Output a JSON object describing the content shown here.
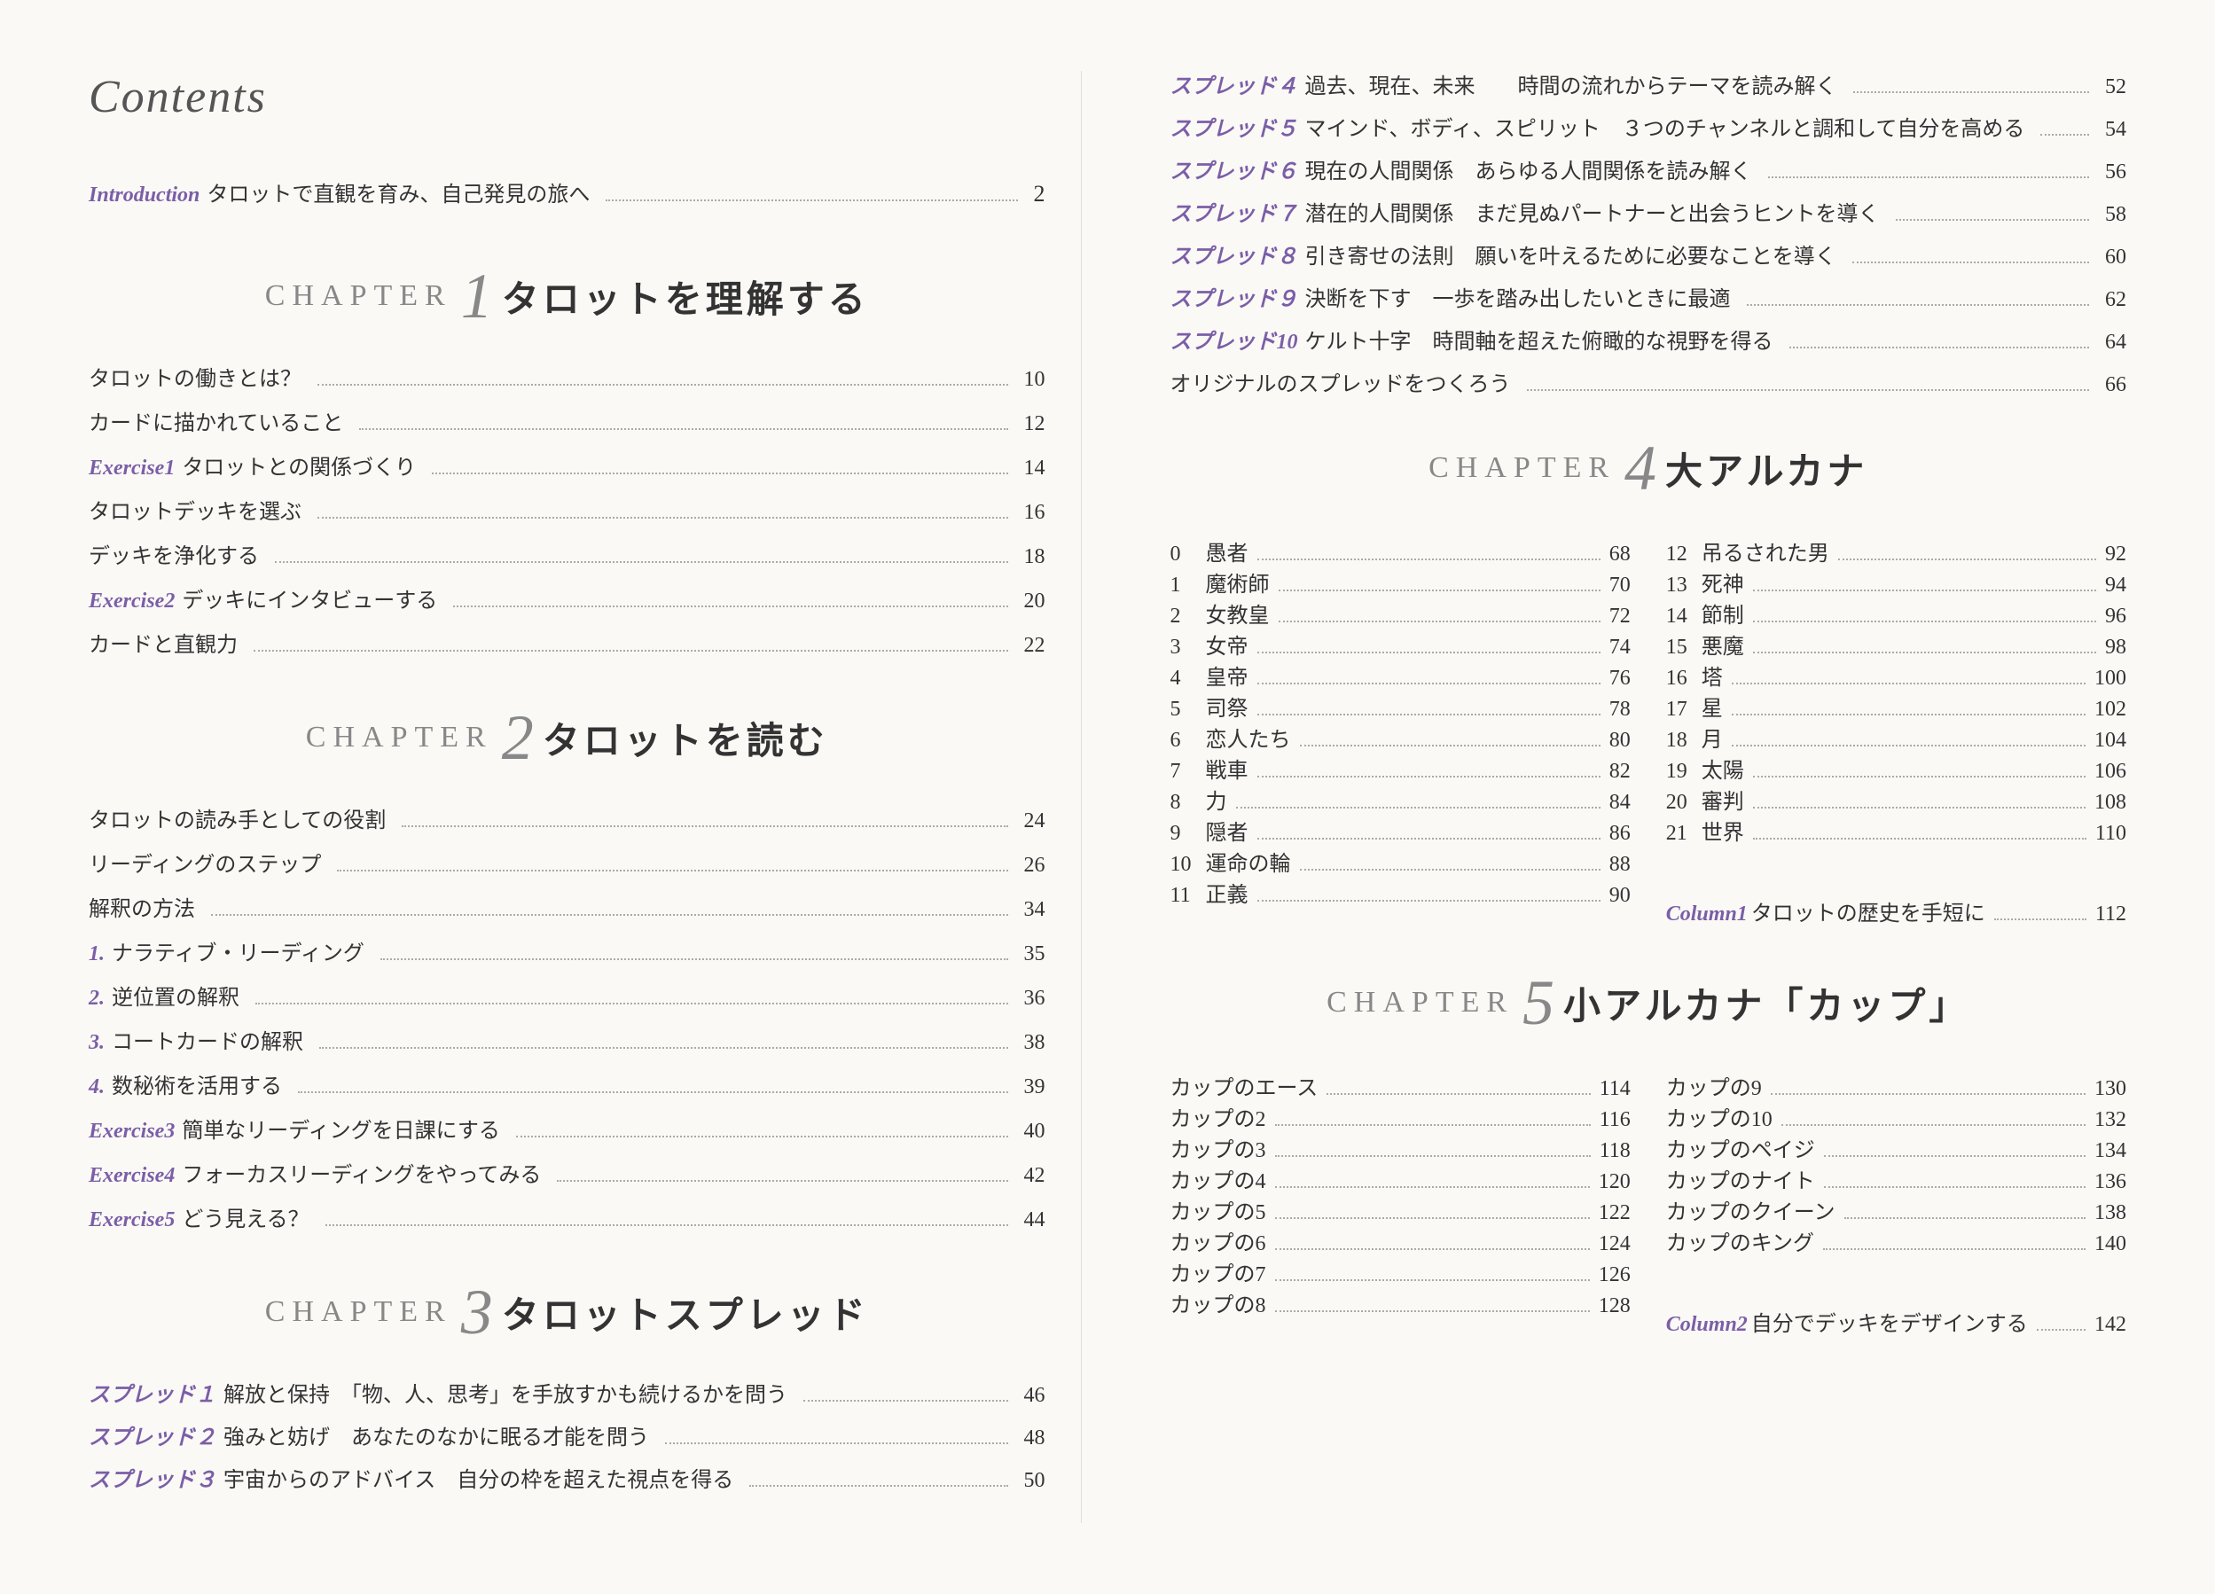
{
  "contents_title": "Contents",
  "introduction": {
    "label": "Introduction",
    "text": "タロットで直観を育み、自己発見の旅へ",
    "page": "2"
  },
  "chapters": [
    {
      "id": "ch1",
      "prefix": "CHAPTER",
      "num": "1",
      "title": "タロットを理解する",
      "entries": [
        {
          "label": "",
          "text": "タロットの働きとは？",
          "page": "10"
        },
        {
          "label": "",
          "text": "カードに描かれていること",
          "page": "12"
        },
        {
          "label": "Exercise1",
          "text": "タロットとの関係づくり",
          "page": "14"
        },
        {
          "label": "",
          "text": "タロットデッキを選ぶ",
          "page": "16"
        },
        {
          "label": "",
          "text": "デッキを浄化する",
          "page": "18"
        },
        {
          "label": "Exercise2",
          "text": "デッキにインタビューする",
          "page": "20"
        },
        {
          "label": "",
          "text": "カードと直観力",
          "page": "22"
        }
      ]
    },
    {
      "id": "ch2",
      "prefix": "CHAPTER",
      "num": "2",
      "title": "タロットを読む",
      "entries": [
        {
          "label": "",
          "text": "タロットの読み手としての役割",
          "page": "24"
        },
        {
          "label": "",
          "text": "リーディングのステップ",
          "page": "26"
        },
        {
          "label": "",
          "text": "解釈の方法",
          "page": "34"
        },
        {
          "label": "1.",
          "text": "ナラティブ・リーディング",
          "page": "35"
        },
        {
          "label": "2.",
          "text": "逆位置の解釈",
          "page": "36"
        },
        {
          "label": "3.",
          "text": "コートカードの解釈",
          "page": "38"
        },
        {
          "label": "4.",
          "text": "数秘術を活用する",
          "page": "39"
        },
        {
          "label": "Exercise3",
          "text": "簡単なリーディングを日課にする",
          "page": "40"
        },
        {
          "label": "Exercise4",
          "text": "フォーカスリーディングをやってみる",
          "page": "42"
        },
        {
          "label": "Exercise5",
          "text": "どう見える？",
          "page": "44"
        }
      ]
    },
    {
      "id": "ch3",
      "prefix": "CHAPTER",
      "num": "3",
      "title": "タロットスプレッド",
      "entries": [
        {
          "label": "スプレッド１",
          "text": "解放と保持",
          "sub": "「物、人、思考」を手放すかも続けるかを問う",
          "page": "46"
        },
        {
          "label": "スプレッド２",
          "text": "強みと妨げ",
          "sub": "あなたのなかに眠る才能を問う",
          "page": "48"
        },
        {
          "label": "スプレッド３",
          "text": "宇宙からのアドバイス",
          "sub": "自分の枠を超えた視点を得る",
          "page": "50"
        }
      ]
    }
  ],
  "right": {
    "ch3_entries": [
      {
        "label": "スプレッド４",
        "text": "過去、現在、未来",
        "sub": "時間の流れからテーマを読み解く",
        "page": "52"
      },
      {
        "label": "スプレッド５",
        "text": "マインド、ボディ、スピリット",
        "sub": "３つのチャンネルと調和して自分を高める",
        "page": "54"
      },
      {
        "label": "スプレッド６",
        "text": "現在の人間関係",
        "sub": "あらゆる人間関係を読み解く",
        "page": "56"
      },
      {
        "label": "スプレッド７",
        "text": "潜在的人間関係",
        "sub": "まだ見ぬパートナーと出会うヒントを導く",
        "page": "58"
      },
      {
        "label": "スプレッド８",
        "text": "引き寄せの法則",
        "sub": "願いを叶えるために必要なことを導く",
        "page": "60"
      },
      {
        "label": "スプレッド９",
        "text": "決断を下す",
        "sub": "一歩を踏み出したいときに最適",
        "page": "62"
      },
      {
        "label": "スプレッド10",
        "text": "ケルト十字",
        "sub": "時間軸を超えた俯瞰的な視野を得る",
        "page": "64"
      },
      {
        "label": "",
        "text": "オリジナルのスプレッドをつくろう",
        "sub": "",
        "page": "66"
      }
    ],
    "ch4": {
      "prefix": "CHAPTER",
      "num": "4",
      "title": "大アルカナ",
      "arcana_left": [
        {
          "num": "0",
          "name": "愚者",
          "page": "68"
        },
        {
          "num": "1",
          "name": "魔術師",
          "page": "70"
        },
        {
          "num": "2",
          "name": "女教皇",
          "page": "72"
        },
        {
          "num": "3",
          "name": "女帝",
          "page": "74"
        },
        {
          "num": "4",
          "name": "皇帝",
          "page": "76"
        },
        {
          "num": "5",
          "name": "司祭",
          "page": "78"
        },
        {
          "num": "6",
          "name": "恋人たち",
          "page": "80"
        },
        {
          "num": "7",
          "name": "戦車",
          "page": "82"
        },
        {
          "num": "8",
          "name": "力",
          "page": "84"
        },
        {
          "num": "9",
          "name": "隠者",
          "page": "86"
        },
        {
          "num": "10",
          "name": "運命の輪",
          "page": "88"
        },
        {
          "num": "11",
          "name": "正義",
          "page": "90"
        }
      ],
      "arcana_right": [
        {
          "num": "12",
          "name": "吊るされた男",
          "page": "92"
        },
        {
          "num": "13",
          "name": "死神",
          "page": "94"
        },
        {
          "num": "14",
          "name": "節制",
          "page": "96"
        },
        {
          "num": "15",
          "name": "悪魔",
          "page": "98"
        },
        {
          "num": "16",
          "name": "塔",
          "page": "100"
        },
        {
          "num": "17",
          "name": "星",
          "page": "102"
        },
        {
          "num": "18",
          "name": "月",
          "page": "104"
        },
        {
          "num": "19",
          "name": "太陽",
          "page": "106"
        },
        {
          "num": "20",
          "name": "審判",
          "page": "108"
        },
        {
          "num": "21",
          "name": "世界",
          "page": "110"
        }
      ],
      "column": {
        "label": "Column1",
        "text": "タロットの歴史を手短に",
        "page": "112"
      }
    },
    "ch5": {
      "prefix": "CHAPTER",
      "num": "5",
      "title": "小アルカナ「カップ」",
      "cups_left": [
        {
          "name": "カップのエース",
          "page": "114"
        },
        {
          "name": "カップの2",
          "page": "116"
        },
        {
          "name": "カップの3",
          "page": "118"
        },
        {
          "name": "カップの4",
          "page": "120"
        },
        {
          "name": "カップの5",
          "page": "122"
        },
        {
          "name": "カップの6",
          "page": "124"
        },
        {
          "name": "カップの7",
          "page": "126"
        },
        {
          "name": "カップの8",
          "page": "128"
        }
      ],
      "cups_right": [
        {
          "name": "カップの9",
          "page": "130"
        },
        {
          "name": "カップの10",
          "page": "132"
        },
        {
          "name": "カップのペイジ",
          "page": "134"
        },
        {
          "name": "カップのナイト",
          "page": "136"
        },
        {
          "name": "カップのクイーン",
          "page": "138"
        },
        {
          "name": "カップのキング",
          "page": "140"
        }
      ],
      "column": {
        "label": "Column2",
        "text": "自分でデッキをデザインする",
        "page": "142"
      }
    }
  },
  "colors": {
    "purple": "#7b5ea7",
    "gray": "#888",
    "text": "#333",
    "dot": "#aaa"
  }
}
